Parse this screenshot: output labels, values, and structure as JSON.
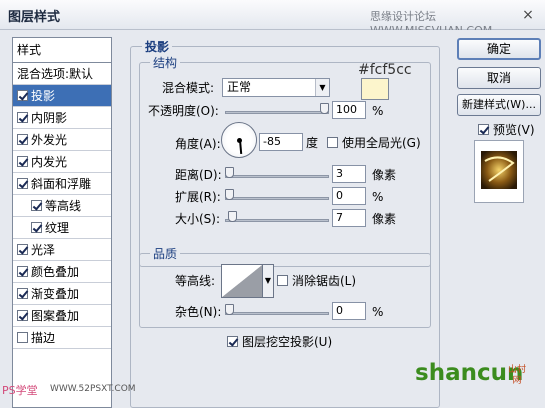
{
  "window": {
    "title": "图层样式",
    "watermark": "思缘设计论坛 WWW.MISSVUAN.COM",
    "close": "×"
  },
  "sidebar": {
    "header": "样式",
    "items": [
      {
        "label": "混合选项:默认",
        "checkbox": false,
        "has_checkbox": false,
        "selected": false,
        "indent": false
      },
      {
        "label": "投影",
        "checkbox": true,
        "has_checkbox": true,
        "selected": true,
        "indent": false
      },
      {
        "label": "内阴影",
        "checkbox": true,
        "has_checkbox": true,
        "selected": false,
        "indent": false
      },
      {
        "label": "外发光",
        "checkbox": true,
        "has_checkbox": true,
        "selected": false,
        "indent": false
      },
      {
        "label": "内发光",
        "checkbox": true,
        "has_checkbox": true,
        "selected": false,
        "indent": false
      },
      {
        "label": "斜面和浮雕",
        "checkbox": true,
        "has_checkbox": true,
        "selected": false,
        "indent": false
      },
      {
        "label": "等高线",
        "checkbox": true,
        "has_checkbox": true,
        "selected": false,
        "indent": true
      },
      {
        "label": "纹理",
        "checkbox": true,
        "has_checkbox": true,
        "selected": false,
        "indent": true
      },
      {
        "label": "光泽",
        "checkbox": true,
        "has_checkbox": true,
        "selected": false,
        "indent": false
      },
      {
        "label": "颜色叠加",
        "checkbox": true,
        "has_checkbox": true,
        "selected": false,
        "indent": false
      },
      {
        "label": "渐变叠加",
        "checkbox": true,
        "has_checkbox": true,
        "selected": false,
        "indent": false
      },
      {
        "label": "图案叠加",
        "checkbox": true,
        "has_checkbox": true,
        "selected": false,
        "indent": false
      },
      {
        "label": "描边",
        "checkbox": false,
        "has_checkbox": true,
        "selected": false,
        "indent": false
      }
    ]
  },
  "shadow": {
    "section_title": "投影",
    "structure": {
      "title": "结构",
      "blend_mode_label": "混合模式:",
      "blend_mode_value": "正常",
      "color_annotation": "#fcf5cc",
      "swatch_color": "#fcf5cc",
      "opacity_label": "不透明度(O):",
      "opacity_value": "100",
      "opacity_fraction": 1.0,
      "percent": "%",
      "angle_label": "角度(A):",
      "angle_value": "-85",
      "angle_unit": "度",
      "global_light_label": "使用全局光(G)",
      "global_light_checked": false,
      "distance_label": "距离(D):",
      "distance_value": "3",
      "distance_fraction": 0.0,
      "spread_label": "扩展(R):",
      "spread_value": "0",
      "spread_fraction": 0.0,
      "size_label": "大小(S):",
      "size_value": "7",
      "size_fraction": 0.03,
      "pixel_unit": "像素"
    },
    "quality": {
      "title": "品质",
      "contour_label": "等高线:",
      "anti_alias_label": "消除锯齿(L)",
      "anti_alias_checked": false,
      "noise_label": "杂色(N):",
      "noise_value": "0",
      "noise_fraction": 0.0,
      "percent": "%"
    },
    "knockout_label": "图层挖空投影(U)",
    "knockout_checked": true
  },
  "buttons": {
    "ok": "确定",
    "cancel": "取消",
    "new_style": "新建样式(W)...",
    "preview_label": "预览(V)",
    "preview_checked": true
  },
  "branding": {
    "site": "shancun",
    "site_sub": "山村网",
    "ps_logo": "PS学堂",
    "ps_url": "WWW.52PSXT.COM"
  }
}
